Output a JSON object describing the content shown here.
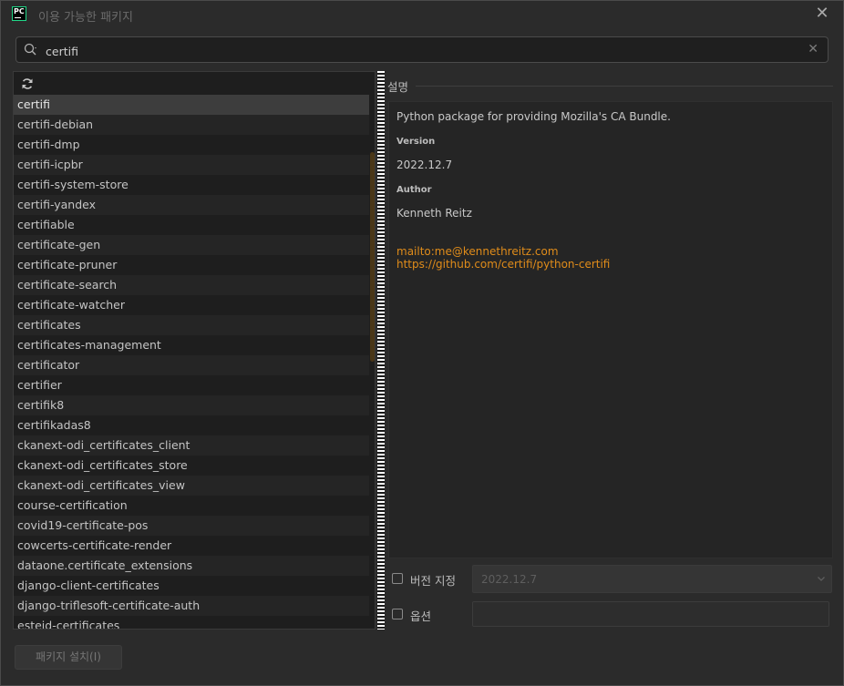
{
  "window": {
    "title": "이용 가능한 패키지",
    "logo_text": "PC",
    "close_glyph": "✕"
  },
  "search": {
    "value": "certifi",
    "icon": "search-icon",
    "clear_glyph": "✕"
  },
  "packages": {
    "refresh_icon": "refresh-icon",
    "selected": "certifi",
    "items": [
      "certifi",
      "certifi-debian",
      "certifi-dmp",
      "certifi-icpbr",
      "certifi-system-store",
      "certifi-yandex",
      "certifiable",
      "certificate-gen",
      "certificate-pruner",
      "certificate-search",
      "certificate-watcher",
      "certificates",
      "certificates-management",
      "certificator",
      "certifier",
      "certifik8",
      "certifikadas8",
      "ckanext-odi_certificates_client",
      "ckanext-odi_certificates_store",
      "ckanext-odi_certificates_view",
      "course-certification",
      "covid19-certificate-pos",
      "cowcerts-certificate-render",
      "dataone.certificate_extensions",
      "django-client-certificates",
      "django-triflesoft-certificate-auth",
      "esteid-certificates"
    ]
  },
  "description": {
    "header": "설명",
    "summary": "Python package for providing Mozilla's CA Bundle.",
    "version_label": "Version",
    "version_value": "2022.12.7",
    "author_label": "Author",
    "author_value": "Kenneth Reitz",
    "email_link": "mailto:me@kennethreitz.com",
    "repo_link": "https://github.com/certifi/python-certifi"
  },
  "options": {
    "specify_version_label": "버전 지정",
    "specify_version_checked": false,
    "version_select_value": "2022.12.7",
    "options_label": "옵션",
    "options_checked": false,
    "options_value": ""
  },
  "footer": {
    "install_label": "패키지 설치(I)"
  },
  "colors": {
    "accent_link": "#e08c1a",
    "selected_row": "#3d3d3d",
    "background": "#2b2b2b"
  }
}
